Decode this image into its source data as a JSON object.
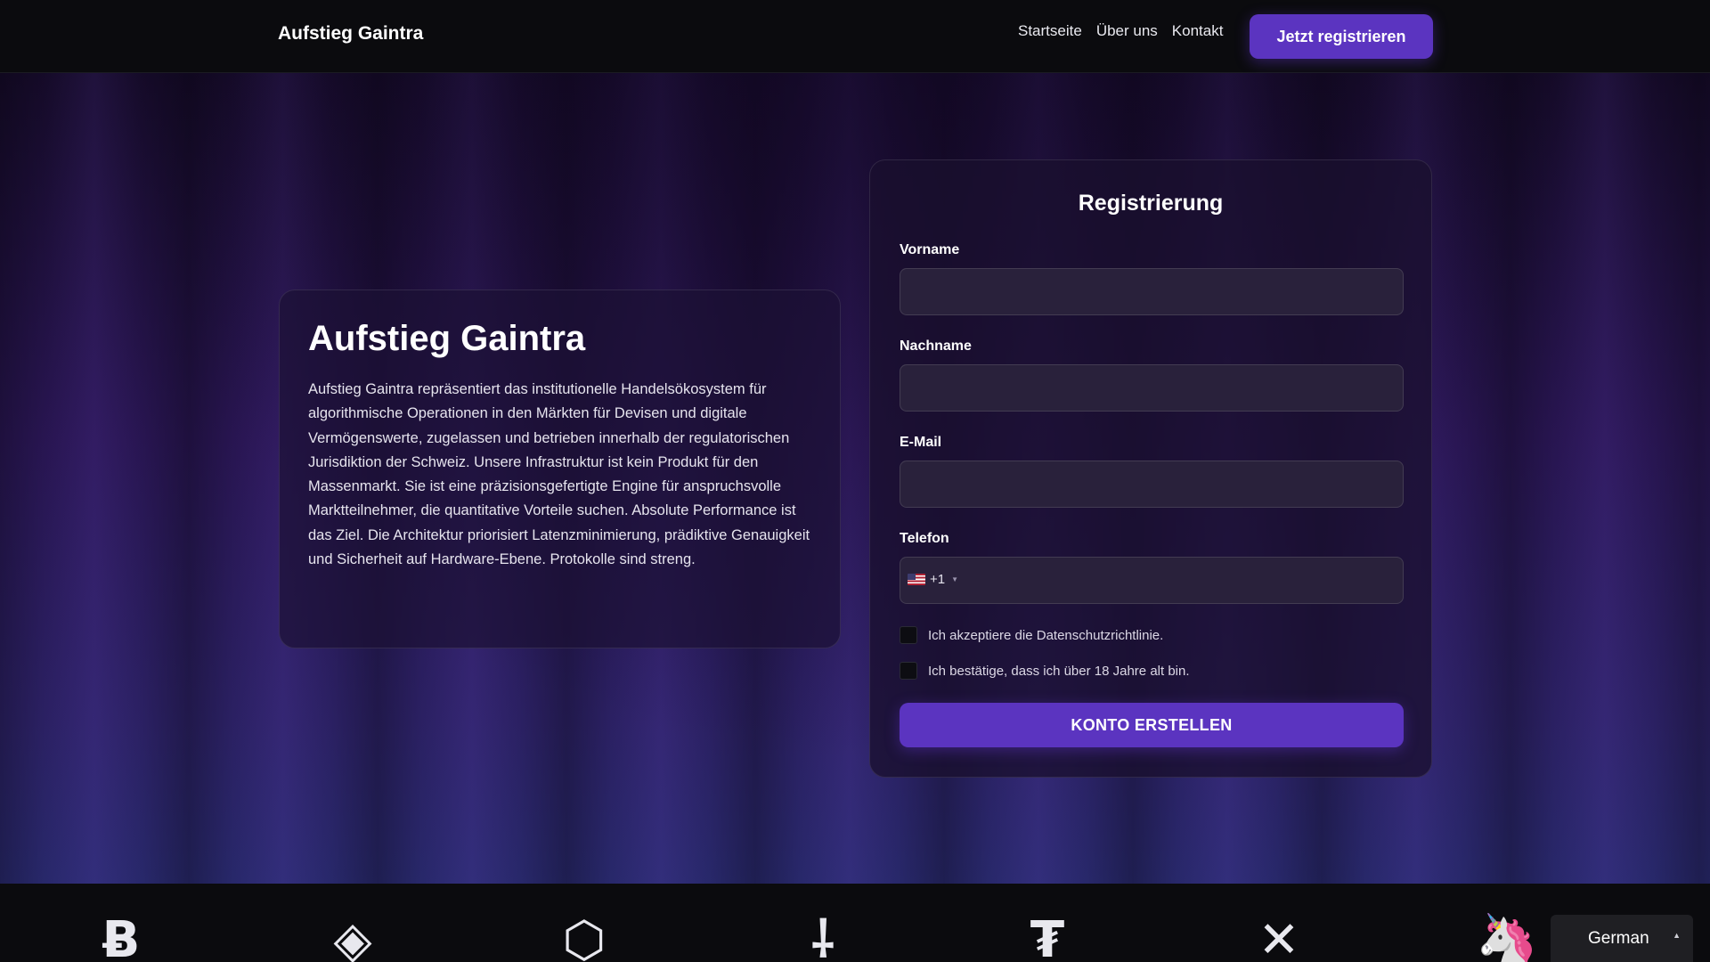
{
  "header": {
    "brand": "Aufstieg Gaintra",
    "nav": [
      "Startseite",
      "Über uns",
      "Kontakt"
    ],
    "cta": "Jetzt registrieren"
  },
  "info": {
    "title": "Aufstieg Gaintra",
    "text": "Aufstieg Gaintra repräsentiert das institutionelle Handelsökosystem für algorithmische Operationen in den Märkten für Devisen und digitale Vermögenswerte, zugelassen und betrieben innerhalb der regulatorischen Jurisdiktion der Schweiz. Unsere Infrastruktur ist kein Produkt für den Massenmarkt. Sie ist eine präzisionsgefertigte Engine für anspruchsvolle Marktteilnehmer, die quantitative Vorteile suchen. Absolute Performance ist das Ziel. Die Architektur priorisiert Latenzminimierung, prädiktive Genauigkeit und Sicherheit auf Hardware-Ebene. Protokolle sind streng."
  },
  "form": {
    "title": "Registrierung",
    "first_name_label": "Vorname",
    "first_name_value": "",
    "last_name_label": "Nachname",
    "last_name_value": "",
    "email_label": "E-Mail",
    "email_value": "",
    "phone_label": "Telefon",
    "phone_country_code": "+1",
    "phone_flag": "us-flag",
    "phone_value": "",
    "privacy_label": "Ich akzeptiere die Datenschutzrichtlinie.",
    "age_label": "Ich bestätige, dass ich über 18 Jahre alt bin.",
    "submit_label": "KONTO ERSTELLEN"
  },
  "coins": [
    {
      "name": "bitcoin-icon",
      "glyph": "Ƀ"
    },
    {
      "name": "binance-icon",
      "glyph": "◈"
    },
    {
      "name": "chainlink-icon",
      "glyph": "⬡"
    },
    {
      "name": "solana-like-icon",
      "glyph": "⸸"
    },
    {
      "name": "tether-icon",
      "glyph": "₮"
    },
    {
      "name": "xrp-icon",
      "glyph": "✕"
    },
    {
      "name": "uniswap-icon",
      "glyph": "🦄"
    }
  ],
  "language": {
    "current": "German"
  },
  "colors": {
    "accent": "#5b34c0",
    "background": "#0b0b0e",
    "input_bg": "#29213b"
  }
}
